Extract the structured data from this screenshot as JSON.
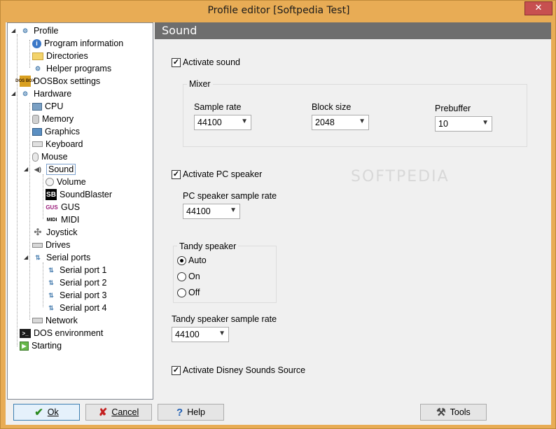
{
  "window": {
    "title": "Profile editor [Softpedia Test]",
    "close_glyph": "✕"
  },
  "tree": {
    "profile": "Profile",
    "program_information": "Program information",
    "directories": "Directories",
    "helper_programs": "Helper programs",
    "dosbox_settings": "DOSBox settings",
    "hardware": "Hardware",
    "cpu": "CPU",
    "memory": "Memory",
    "graphics": "Graphics",
    "keyboard": "Keyboard",
    "mouse": "Mouse",
    "sound": "Sound",
    "volume": "Volume",
    "soundblaster": "SoundBlaster",
    "gus": "GUS",
    "midi": "MIDI",
    "joystick": "Joystick",
    "drives": "Drives",
    "serial_ports": "Serial ports",
    "serial_port_1": "Serial port 1",
    "serial_port_2": "Serial port 2",
    "serial_port_3": "Serial port 3",
    "serial_port_4": "Serial port 4",
    "network": "Network",
    "dos_environment": "DOS environment",
    "starting": "Starting",
    "icon_text": {
      "dosbox": "DOS BOX",
      "sb": "SB",
      "gus": "GUS",
      "midi": "MIDI",
      "info": "i"
    }
  },
  "panel": {
    "header": "Sound",
    "activate_sound": {
      "label": "Activate sound",
      "checked": true
    },
    "mixer": {
      "title": "Mixer",
      "sample_rate_label": "Sample rate",
      "sample_rate_value": "44100",
      "block_size_label": "Block size",
      "block_size_value": "2048",
      "prebuffer_label": "Prebuffer",
      "prebuffer_value": "10"
    },
    "activate_pc_speaker": {
      "label": "Activate PC speaker",
      "checked": true
    },
    "pc_speaker_rate_label": "PC speaker sample rate",
    "pc_speaker_rate_value": "44100",
    "tandy": {
      "title": "Tandy speaker",
      "options": [
        "Auto",
        "On",
        "Off"
      ],
      "selected": "Auto"
    },
    "tandy_rate_label": "Tandy speaker sample rate",
    "tandy_rate_value": "44100",
    "activate_disney": {
      "label": "Activate Disney Sounds Source",
      "checked": true
    },
    "watermark": "SOFTPEDIA"
  },
  "buttons": {
    "ok": "Ok",
    "cancel": "Cancel",
    "help": "Help",
    "tools": "Tools"
  },
  "colors": {
    "title_bar": "#e8ac55",
    "close": "#c75050",
    "header": "#6e6e6e",
    "selection_border": "#7da2ce"
  }
}
